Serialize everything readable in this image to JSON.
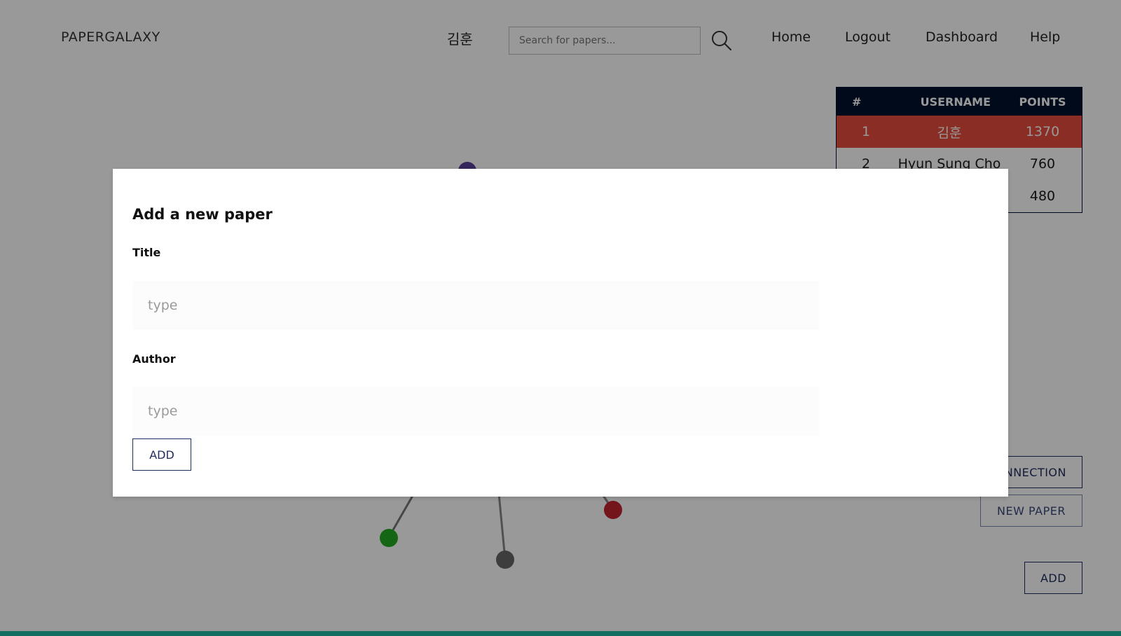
{
  "header": {
    "brand": "PAPERGALAXY",
    "user": "김훈",
    "search_placeholder": "Search for papers...",
    "nav": [
      "Home",
      "Logout",
      "Dashboard",
      "Help"
    ]
  },
  "leaderboard": {
    "columns": [
      "#",
      "USERNAME",
      "POINTS"
    ],
    "rows": [
      {
        "rank": "1",
        "username": "김훈",
        "points": "1370"
      },
      {
        "rank": "2",
        "username": "Hyun Sung Cho",
        "points": "760"
      },
      {
        "rank": "",
        "username": "",
        "points": "480"
      }
    ]
  },
  "side_buttons": {
    "connection": "NNECTION",
    "new_paper": "NEW PAPER",
    "add": "ADD"
  },
  "graph": {
    "node_colors": {
      "purple": "#5b3f9a",
      "green": "#22aa22",
      "gray": "#666666",
      "red": "#c0242c"
    }
  },
  "modal": {
    "title": "Add a new paper",
    "title_label": "Title",
    "title_placeholder": "type",
    "author_label": "Author",
    "author_placeholder": "type",
    "add_label": "ADD"
  }
}
